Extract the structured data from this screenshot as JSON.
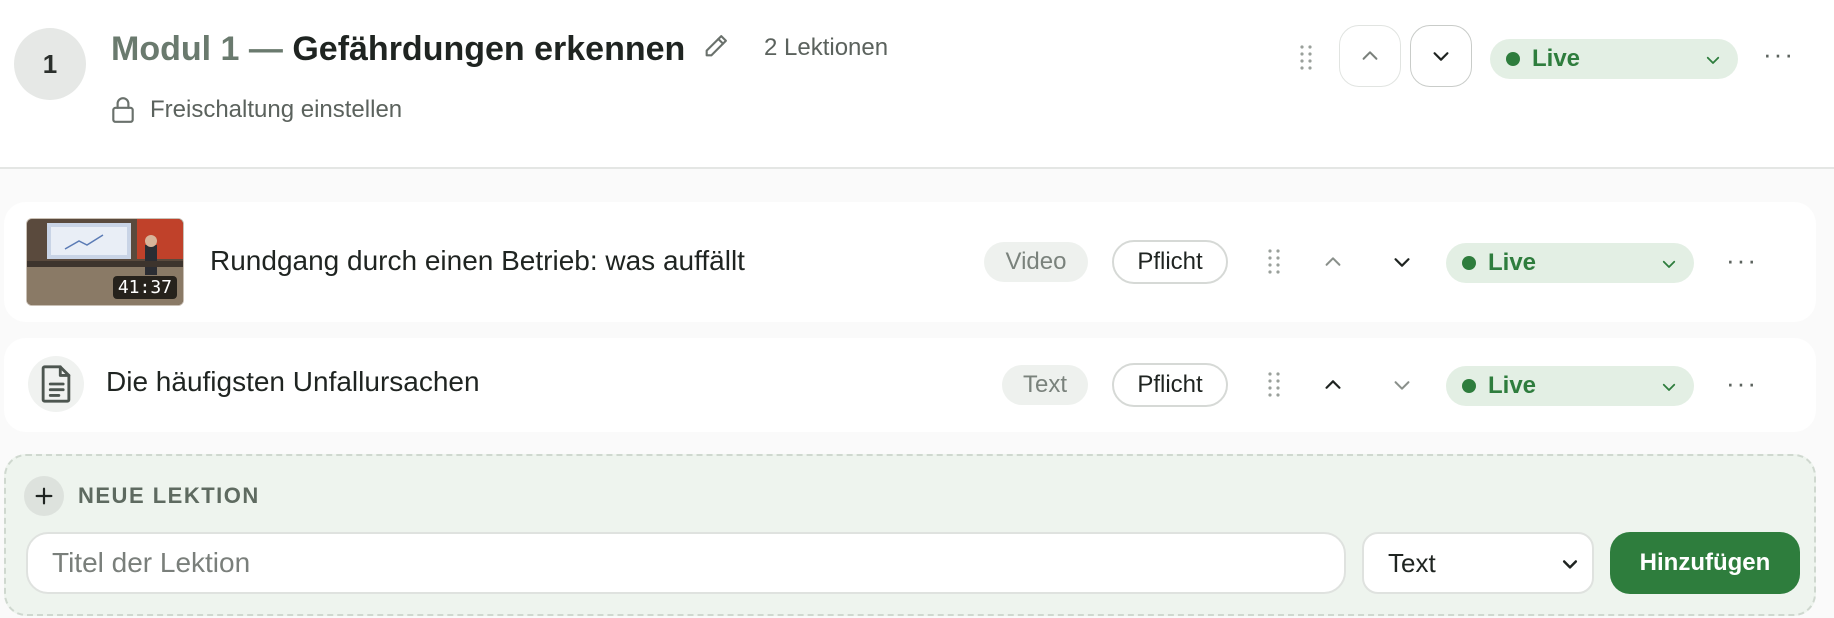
{
  "module": {
    "number": "1",
    "title_prefix": "Modul 1 —",
    "title_name": "Gefährdungen erkennen",
    "lesson_count": "2 Lektionen",
    "unlock_label": "Freischaltung einstellen",
    "status": "Live",
    "more": "···"
  },
  "lessons": [
    {
      "title": "Rundgang durch einen Betrieb: was auffällt",
      "duration": "41:37",
      "type": "Video",
      "required": "Pflicht",
      "status": "Live",
      "more": "···"
    },
    {
      "title": "Die häufigsten Unfallursachen",
      "type": "Text",
      "required": "Pflicht",
      "status": "Live",
      "more": "···"
    }
  ],
  "new_lesson": {
    "label": "NEUE LEKTION",
    "title_placeholder": "Titel der Lektion",
    "type_selected": "Text",
    "add_label": "Hinzufügen"
  },
  "colors": {
    "accent_green": "#2e7d3d",
    "status_bg": "#e3efe4",
    "new_panel_bg": "#eef4ee"
  }
}
